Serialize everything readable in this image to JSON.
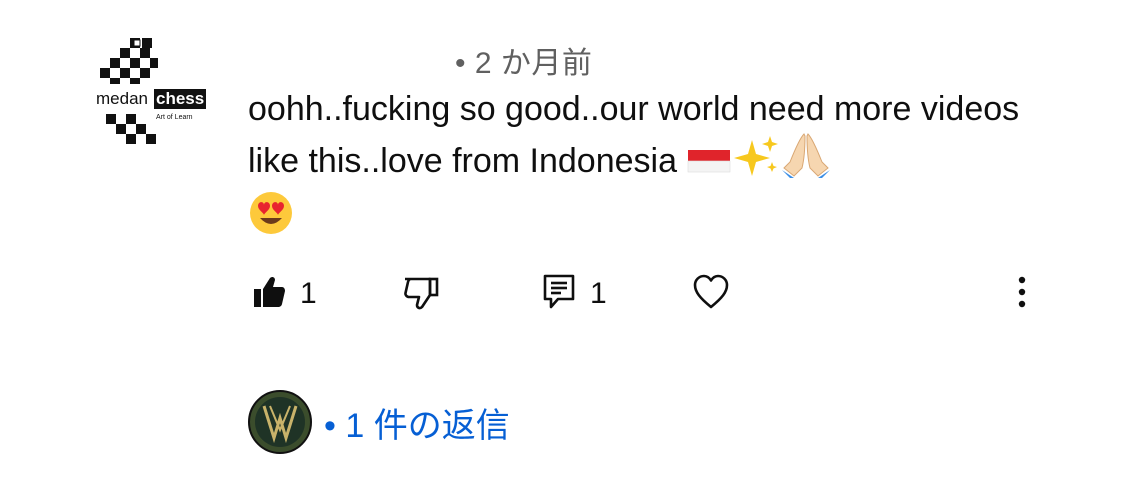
{
  "comment": {
    "author_logo_text": "medan",
    "author_logo_badge": "chess",
    "author_logo_tagline": "Art of Learn",
    "time_ago": "• 2 か月前",
    "text": "oohh..fucking so good..our world need more videos like this..love from Indonesia",
    "emojis": [
      "indonesia-flag",
      "sparkles",
      "folded-hands",
      "heart-eyes-face"
    ]
  },
  "actions": {
    "like_count": "1",
    "reply_count": "1"
  },
  "replies": {
    "label": "• 1 件の返信"
  },
  "colors": {
    "link_blue": "#065fd4",
    "meta_gray": "#606060",
    "text": "#0f0f0f"
  }
}
